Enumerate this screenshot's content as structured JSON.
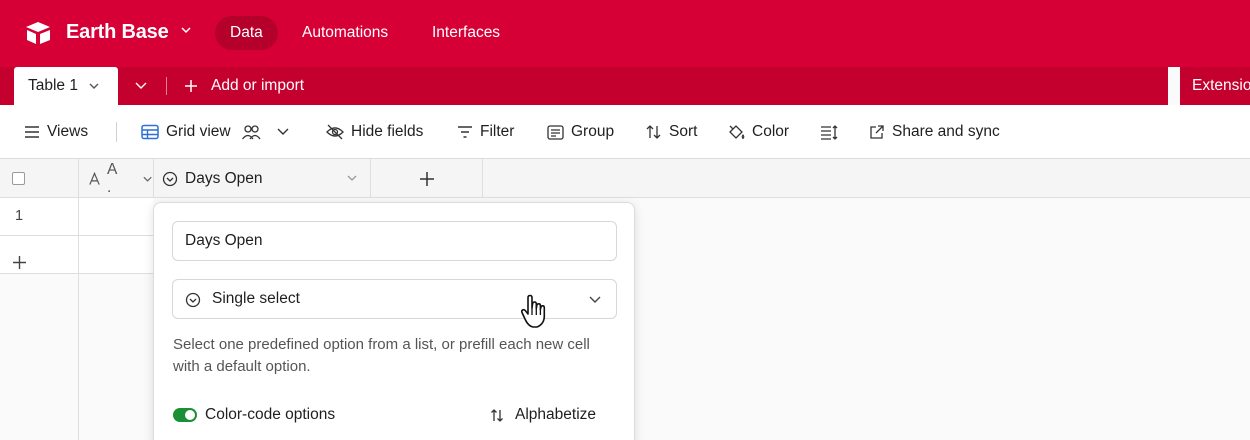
{
  "header": {
    "base_name": "Earth Base",
    "nav": [
      "Data",
      "Automations",
      "Interfaces"
    ],
    "active_nav": "Data",
    "brand_color": "#d60036"
  },
  "tabs": {
    "table_tab": "Table 1",
    "add_import": "Add or import",
    "extensions": "Extensions"
  },
  "toolbar": {
    "views": "Views",
    "grid_view": "Grid view",
    "hide_fields": "Hide fields",
    "filter": "Filter",
    "group": "Group",
    "sort": "Sort",
    "color": "Color",
    "share": "Share and sync"
  },
  "grid": {
    "col_a_label": "A .",
    "col_b_label": "Days Open",
    "rows": [
      "1"
    ]
  },
  "field_editor": {
    "field_name": "Days Open",
    "field_type": "Single select",
    "description": "Select one predefined option from a list, or prefill each new cell with a default option.",
    "color_code_label": "Color-code options",
    "color_code_on": true,
    "alphabetize_label": "Alphabetize"
  },
  "icons": [
    "logo-icon",
    "chevron-down-icon",
    "plus-icon",
    "menu-icon",
    "grid-icon",
    "people-icon",
    "eye-off-icon",
    "filter-icon",
    "group-icon",
    "sort-icon",
    "paint-bucket-icon",
    "row-height-icon",
    "share-icon",
    "checkbox-icon",
    "text-field-icon",
    "single-select-icon",
    "pointer-hand-icon"
  ]
}
